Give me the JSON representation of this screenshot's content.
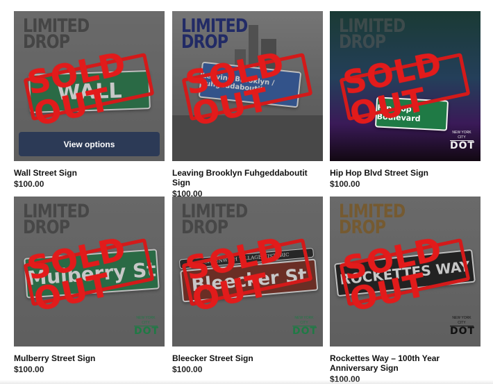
{
  "badge": {
    "line1": "LIMITED",
    "line2": "DROP",
    "stamp": "SOLD OUT"
  },
  "dot_logo": {
    "top": "NEW YORK CITY",
    "big": "DOT"
  },
  "view_options_label": "View options",
  "products": [
    {
      "name": "Wall Street Sign",
      "price": "$100.00",
      "sign_text": "WALL",
      "ltd_color": "#3a3a3a"
    },
    {
      "name": "Leaving Brooklyn Fuhgeddaboutit Sign",
      "price": "$100.00",
      "sign_text": "Leaving Brooklyn / Fuhgeddaboutit",
      "ltd_color": "#1b2a66"
    },
    {
      "name": "Hip Hop Blvd Street Sign",
      "price": "$100.00",
      "sign_text": "Hip Hop / Boulevard",
      "ltd_color": "#3a3a3a"
    },
    {
      "name": "Mulberry Street Sign",
      "price": "$100.00",
      "sign_text": "Mulberry St",
      "ltd_color": "#3a3a3a"
    },
    {
      "name": "Bleecker Street Sign",
      "price": "$100.00",
      "sign_text": "Bleecker St",
      "top_text": "GREENWICH VILLAGE HISTORIC",
      "ltd_color": "#3a3a3a"
    },
    {
      "name": "Rockettes Way – 100th Year Anniversary Sign",
      "price": "$100.00",
      "sign_text": "ROCKETTES WAY",
      "ltd_color": "#7a5a28"
    }
  ],
  "colors": {
    "button": "#2c3a56",
    "stamp_red": "#e21b1b",
    "street_green": "#1f7a45"
  }
}
